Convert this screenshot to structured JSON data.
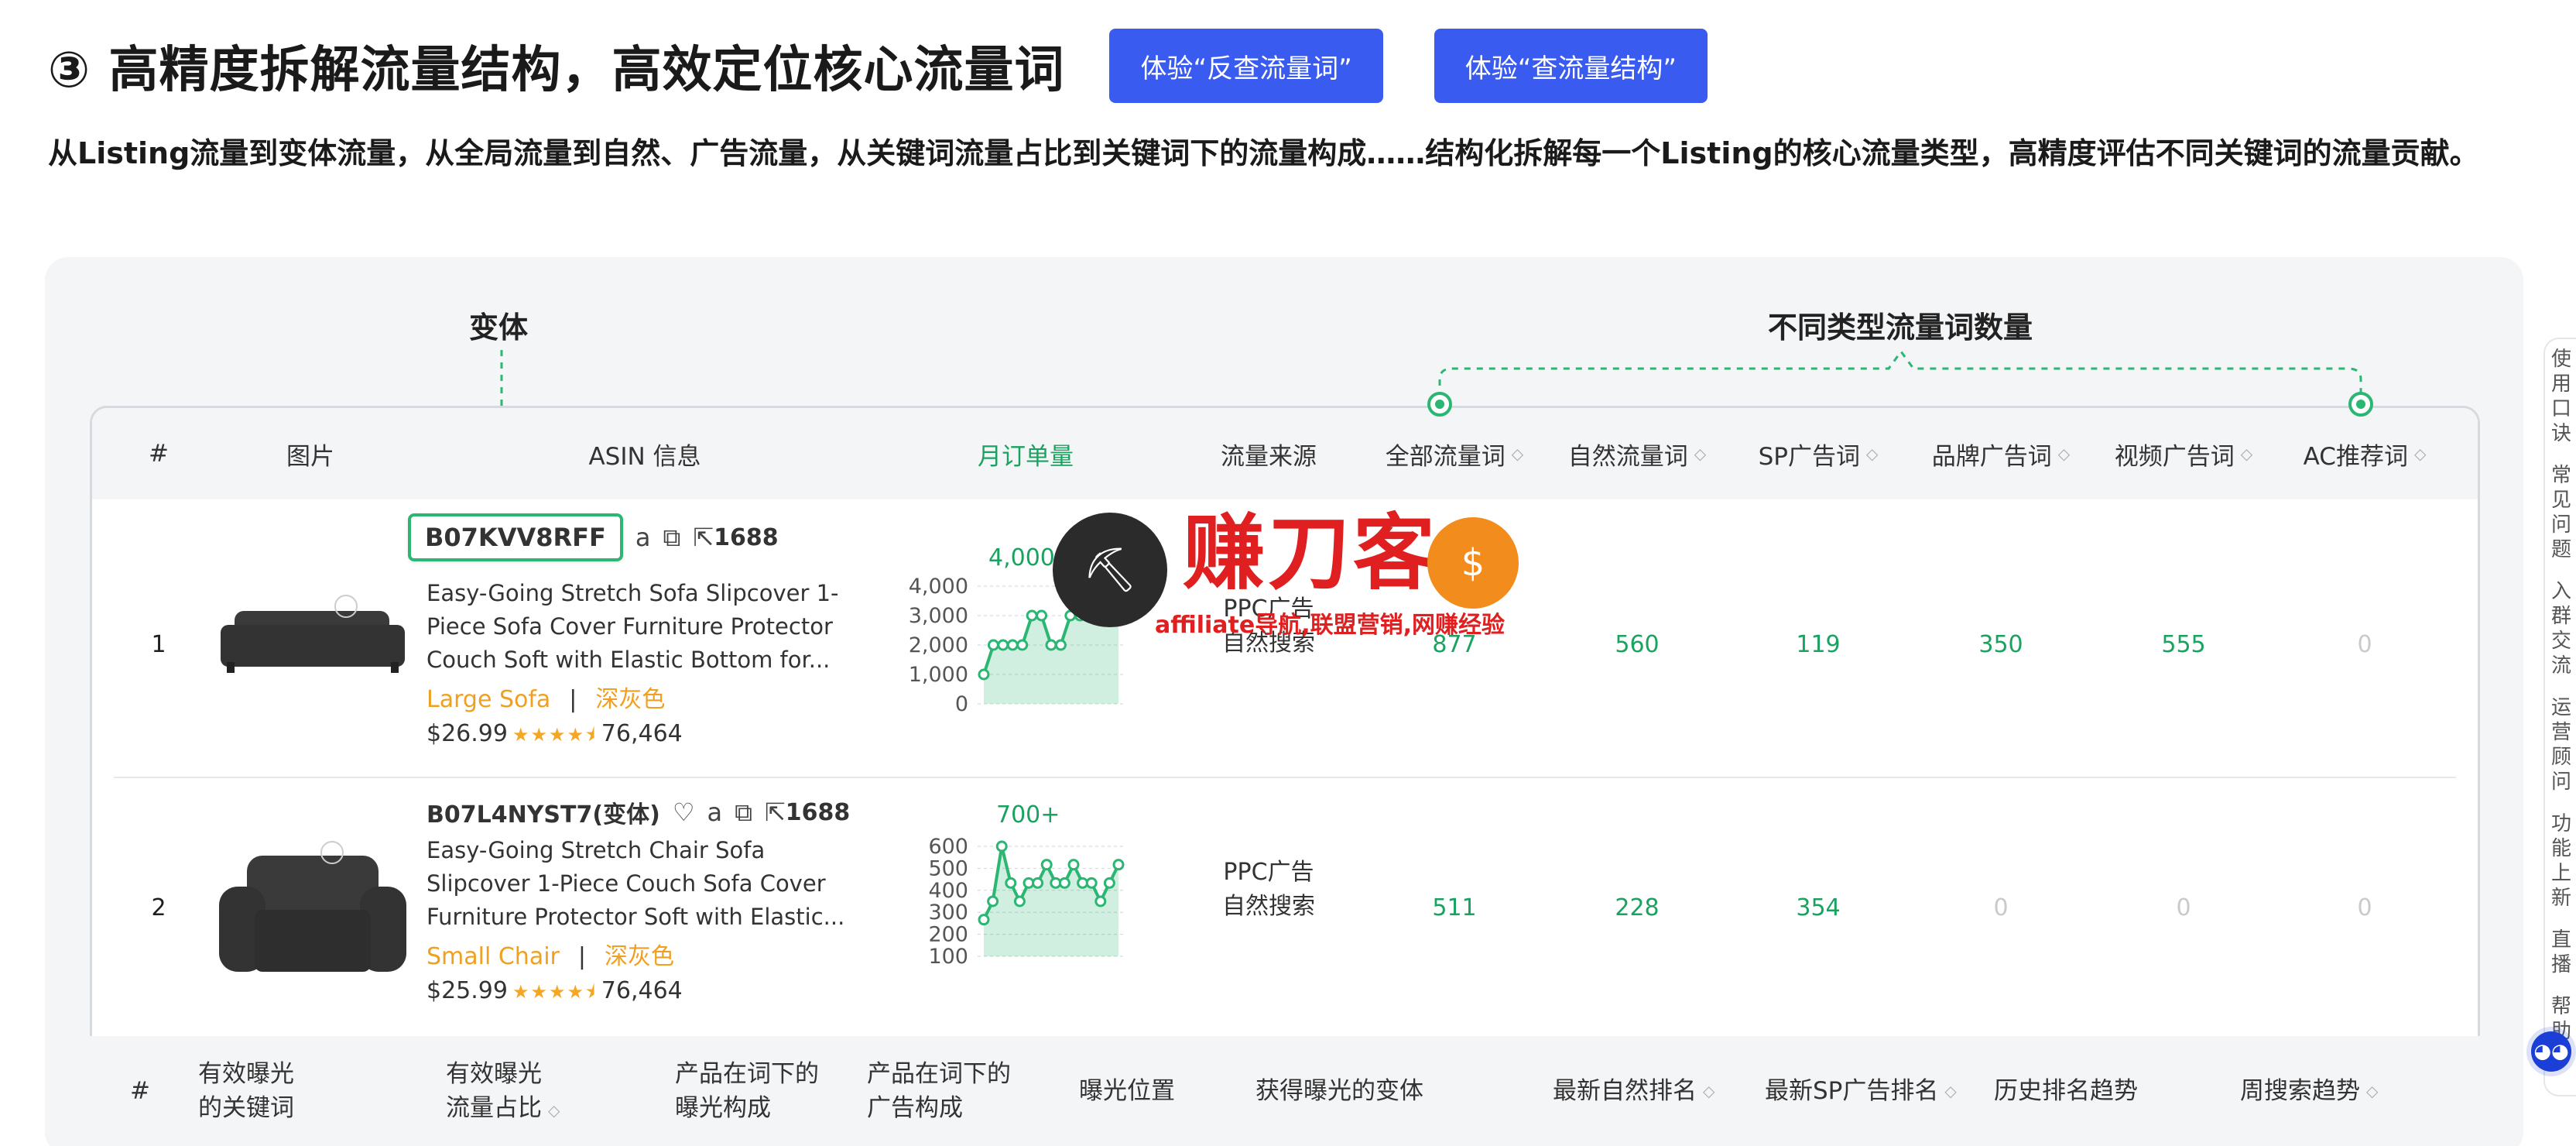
{
  "header": {
    "title": "③ 高精度拆解流量结构，高效定位核心流量词",
    "buttons": [
      "体验“反查流量词”",
      "体验“查流量结构”"
    ]
  },
  "description": "从Listing流量到变体流量，从全局流量到自然、广告流量，从关键词流量占比到关键词下的流量构成……结构化拆解每一个Listing的核心流量类型，高精度评估不同关键词的流量贡献。",
  "annotations": {
    "variant": "变体",
    "keyword_types": "不同类型流量词数量"
  },
  "columns": [
    "#",
    "图片",
    "ASIN 信息",
    "月订单量",
    "流量来源",
    "全部流量词",
    "自然流量词",
    "SP广告词",
    "品牌广告词",
    "视频广告词",
    "AC推荐词"
  ],
  "rows": [
    {
      "index": "1",
      "asin": "B07KVV8RFF",
      "link_1688": "1688",
      "title": "Easy-Going Stretch Sofa Slipcover 1-Piece Sofa Cover Furniture Protector Couch Soft with Elastic Bottom for...",
      "size": "Large Sofa",
      "color": "深灰色",
      "separator": "|",
      "price": "$26.99",
      "stars": "★★★★⯨",
      "rating": 4.5,
      "reviews": "76,464",
      "orders_label": "4,000+",
      "orders_chart": {
        "type": "area",
        "yticks": [
          "4,000",
          "3,000",
          "2,000",
          "1,000",
          "0"
        ],
        "ylim": [
          0,
          4000
        ],
        "values": [
          1000,
          2000,
          2000,
          2000,
          2000,
          3000,
          3000,
          2000,
          2000,
          3000,
          3000,
          3000,
          3000,
          3000,
          3000
        ]
      },
      "traffic_source": [
        "PPC广告",
        "自然搜索"
      ],
      "all_keywords": "877",
      "organic_keywords": "560",
      "sp_keywords": "119",
      "brand_keywords": "350",
      "video_keywords": "555",
      "ac_keywords": "0"
    },
    {
      "index": "2",
      "asin": "B07L4NYST7(变体)",
      "link_1688": "1688",
      "title": "Easy-Going Stretch Chair Sofa Slipcover 1-Piece Couch Sofa Cover Furniture Protector Soft with Elastic...",
      "size": "Small Chair",
      "color": "深灰色",
      "separator": "|",
      "price": "$25.99",
      "stars": "★★★★⯨",
      "rating": 4.5,
      "reviews": "76,464",
      "orders_label": "700+",
      "orders_chart": {
        "type": "area",
        "yticks": [
          "600",
          "500",
          "400",
          "300",
          "200",
          "100"
        ],
        "ylim": [
          100,
          700
        ],
        "values": [
          300,
          400,
          700,
          500,
          400,
          500,
          500,
          600,
          500,
          500,
          600,
          500,
          500,
          400,
          500,
          600
        ]
      },
      "traffic_source": [
        "PPC广告",
        "自然搜索"
      ],
      "all_keywords": "511",
      "organic_keywords": "228",
      "sp_keywords": "354",
      "brand_keywords": "0",
      "video_keywords": "0",
      "ac_keywords": "0"
    }
  ],
  "bottom_columns": [
    [
      "#"
    ],
    [
      "有效曝光",
      "的关键词"
    ],
    [
      "有效曝光",
      "流量占比"
    ],
    [
      "产品在词下的",
      "曝光构成"
    ],
    [
      "产品在词下的",
      "广告构成"
    ],
    [
      "曝光位置"
    ],
    [
      "获得曝光的变体"
    ],
    [
      "最新自然排名"
    ],
    [
      "最新SP广告排名"
    ],
    [
      "历史排名趋势"
    ],
    [
      "周搜索趋势"
    ]
  ],
  "sidebar": [
    "使用口诀",
    "常见问题",
    "入群交流",
    "运营顾问",
    "功能上新",
    "直播",
    "帮助"
  ],
  "watermark": {
    "title": "赚刀客",
    "subtitle": "affiliate导航,联盟营销,网赚经验"
  },
  "colors": {
    "accent_blue": "#3a5bf0",
    "accent_green": "#1aa260",
    "variant_orange": "#f0a020",
    "star": "#f5a623"
  }
}
